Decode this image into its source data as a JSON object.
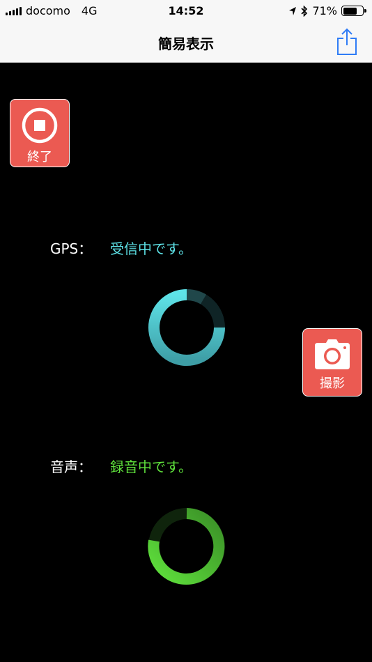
{
  "status_bar": {
    "carrier": "docomo",
    "network": "4G",
    "time": "14:52",
    "battery": "71%",
    "battery_level": 0.71
  },
  "nav": {
    "title": "簡易表示"
  },
  "buttons": {
    "stop_label": "終了",
    "camera_label": "撮影"
  },
  "gps": {
    "label": "GPS：",
    "status": "受信中です。",
    "color": "#5ee3e8"
  },
  "audio": {
    "label": "音声：",
    "status": "録音中です。",
    "color": "#5fe13c"
  },
  "colors": {
    "button_red": "#eb5a52",
    "share_blue": "#2f7cf6"
  }
}
